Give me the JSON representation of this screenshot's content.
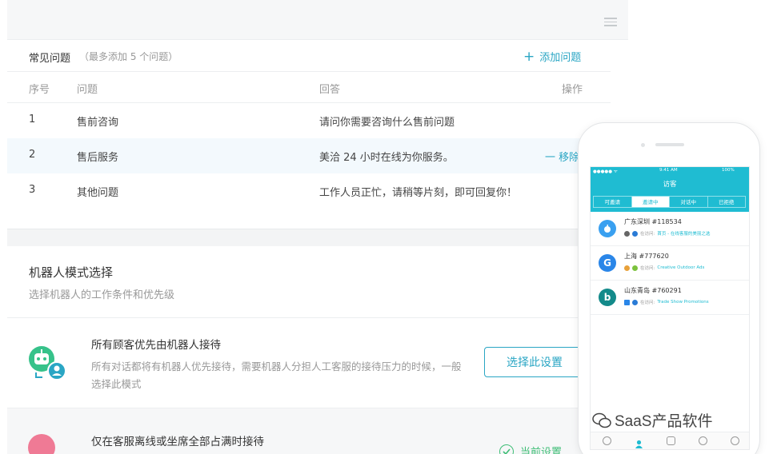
{
  "faq": {
    "title": "常见问题",
    "subtitle": "（最多添加 5 个问题）",
    "add_label": "添加问题",
    "headers": {
      "num": "序号",
      "question": "问题",
      "answer": "回答",
      "op": "操作"
    },
    "rows": [
      {
        "num": "1",
        "question": "售前咨询",
        "answer": "请问你需要咨询什么售前问题",
        "op": ""
      },
      {
        "num": "2",
        "question": "售后服务",
        "answer": "美洽 24 小时在线为你服务。",
        "op": "一 移除"
      },
      {
        "num": "3",
        "question": "其他问题",
        "answer": "工作人员正忙，请稍等片刻，即可回复你！",
        "op": ""
      }
    ]
  },
  "robot": {
    "title": "机器人模式选择",
    "subtitle": "选择机器人的工作条件和优先级",
    "option1": {
      "title": "所有顾客优先由机器人接待",
      "desc": "所有对话都将有机器人优先接待，需要机器人分担人工客服的接待压力的时候，一般选择此模式",
      "button": "选择此设置"
    },
    "option2": {
      "title": "仅在客服离线或坐席全部占满时接待",
      "status": "当前设置"
    }
  },
  "phone": {
    "status": {
      "carrier": "●●●●● ᯤ",
      "time": "9:41 AM",
      "battery": "100%"
    },
    "title": "访客",
    "tabs": [
      "可邀请",
      "邀请中",
      "对话中",
      "已拒绝"
    ],
    "visitors": [
      {
        "title": "广东深圳 #118534",
        "prefix": "在访问:",
        "link": "首页 - 在线客服的美丽之选",
        "avatar": ""
      },
      {
        "title": "上海 #777620",
        "prefix": "在访问:",
        "link": "Creative Outdoor Ads",
        "avatar": "G"
      },
      {
        "title": "山东青岛 #760291",
        "prefix": "在访问:",
        "link": "Trade Show Promotions",
        "avatar": "b"
      }
    ]
  },
  "watermark": "SaaS产品软件",
  "colors": {
    "accent": "#2aa6c4",
    "success": "#3dbd75",
    "phone_header": "#1fbcd2"
  }
}
